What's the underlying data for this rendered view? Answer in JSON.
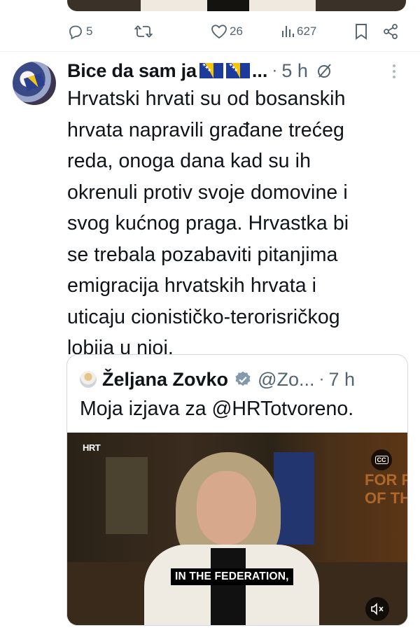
{
  "previous_post": {
    "actions": {
      "replies": "5",
      "likes": "26",
      "views": "627"
    }
  },
  "tweet": {
    "author_name": "Bice da sam ja",
    "name_suffix": "...",
    "separator": "·",
    "time": "5 h",
    "body_lines": [
      "Hrvatski hrvati su od bosanskih",
      "hrvata napravili građane trećeg",
      "reda, onoga dana kad su ih",
      "okrenuli protiv svoje domovine i",
      "svog kućnog praga. Hrvastka bi",
      "se trebala pozabaviti pitanjima",
      "emigracija hrvatskih hrvata i",
      "uticaju cionističko-terorisričkog",
      "lobija u njoj."
    ]
  },
  "quote": {
    "author_name": "Željana Zovko",
    "handle": "@Zo...",
    "separator": "·",
    "time": "7 h",
    "text": "Moja izjava za @HRTotvoreno.",
    "video": {
      "logo": "HRT",
      "caption": "IN THE FEDERATION,",
      "cc_label": "CC",
      "background_text": "FOR F\nOF TH"
    }
  },
  "colors": {
    "text": "#0f1419",
    "secondary": "#536471",
    "border": "#cfd9de",
    "verified": "#829aab"
  }
}
